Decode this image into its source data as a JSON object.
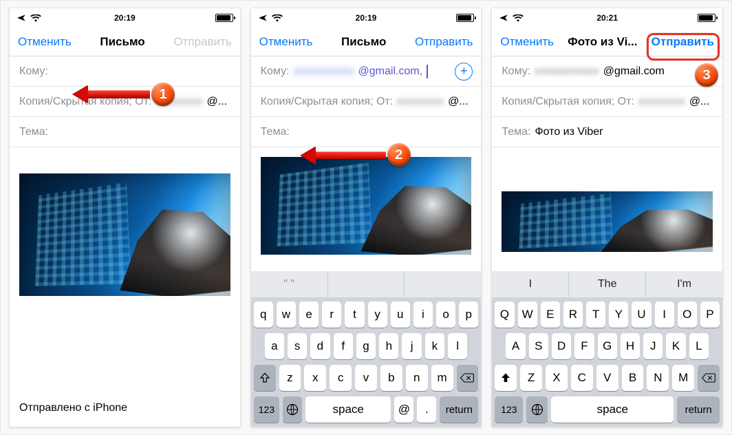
{
  "statusbar": {
    "time1": "20:19",
    "time2": "20:19",
    "time3": "20:21"
  },
  "nav": {
    "cancel": "Отменить",
    "send": "Отправить",
    "title1": "Письмо",
    "title2": "Письмо",
    "title3": "Фото из Vi..."
  },
  "fields": {
    "to_label": "Кому:",
    "cc_label": "Копия/Скрытая копия; От:",
    "subject_label": "Тема:",
    "to_value_tail": "@gmail.com",
    "to_value_tail_comma": "@gmail.com,",
    "cc_tail": "@...",
    "subject3": "Фото из Viber"
  },
  "signature": "Отправлено с iPhone",
  "keyboard": {
    "suggestions_empty": [
      "\"​\"",
      "",
      ""
    ],
    "suggestions3": [
      "I",
      "The",
      "I'm"
    ],
    "rows_lower": [
      [
        "q",
        "w",
        "e",
        "r",
        "t",
        "y",
        "u",
        "i",
        "o",
        "p"
      ],
      [
        "a",
        "s",
        "d",
        "f",
        "g",
        "h",
        "j",
        "k",
        "l"
      ],
      [
        "z",
        "x",
        "c",
        "v",
        "b",
        "n",
        "m"
      ]
    ],
    "rows_upper": [
      [
        "Q",
        "W",
        "E",
        "R",
        "T",
        "Y",
        "U",
        "I",
        "O",
        "P"
      ],
      [
        "A",
        "S",
        "D",
        "F",
        "G",
        "H",
        "J",
        "K",
        "L"
      ],
      [
        "Z",
        "X",
        "C",
        "V",
        "B",
        "N",
        "M"
      ]
    ],
    "n123": "123",
    "space": "space",
    "return": "return",
    "at": "@",
    "dot": "."
  },
  "annotations": {
    "b1": "1",
    "b2": "2",
    "b3": "3"
  }
}
